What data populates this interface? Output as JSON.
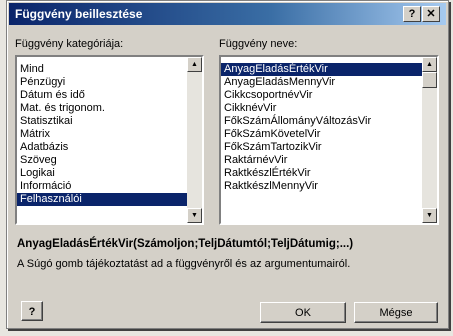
{
  "window": {
    "title": "Függvény beillesztése",
    "help_glyph": "?",
    "close_glyph": "✕"
  },
  "categories": {
    "label": "Függvény kategóriája:",
    "items": [
      "Mind",
      "Pénzügyi",
      "Dátum és idő",
      "Mat. és trigonom.",
      "Statisztikai",
      "Mátrix",
      "Adatbázis",
      "Szöveg",
      "Logikai",
      "Információ",
      "Felhasználói"
    ],
    "selected": "Felhasználói"
  },
  "functions": {
    "label": "Függvény neve:",
    "items": [
      "AnyagEladásÉrtékVir",
      "AnyagEladásMennyVir",
      "CikkcsoportnévVir",
      "CikknévVir",
      "FőkSzámÁllományVáltozásVir",
      "FőkSzámKövetelVir",
      "FőkSzámTartozikVir",
      "RaktárnévVir",
      "RaktkészlÉrtékVir",
      "RaktkészlMennyVir"
    ],
    "selected": "AnyagEladásÉrtékVir"
  },
  "syntax": "AnyagEladásÉrtékVir(Számoljon;TeljDátumtól;TeljDátumig;...)",
  "description": "A Súgó gomb tájékoztatást ad a függvényről és az argumentumairól.",
  "buttons": {
    "help": "?",
    "ok": "OK",
    "cancel": "Mégse"
  },
  "icons": {
    "scroll_up": "▲",
    "scroll_down": "▼"
  }
}
